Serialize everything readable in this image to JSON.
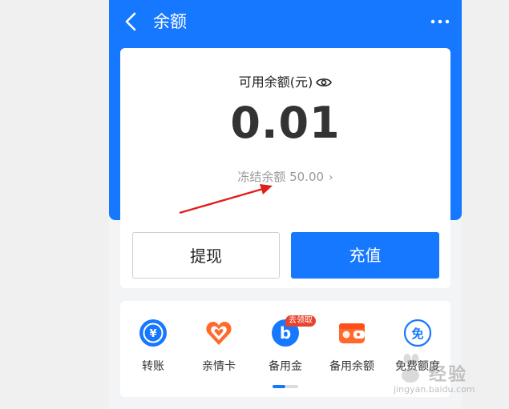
{
  "header": {
    "title": "余额",
    "back_icon": "back-arrow-icon",
    "more_icon": "more-dots-icon"
  },
  "balance": {
    "available_label": "可用余额(元)",
    "amount": "0.01",
    "frozen_label": "冻结余额 50.00"
  },
  "actions": {
    "withdraw": "提现",
    "recharge": "充值"
  },
  "services": [
    {
      "label": "转账",
      "icon": "transfer-icon"
    },
    {
      "label": "亲情卡",
      "icon": "family-card-icon"
    },
    {
      "label": "备用金",
      "icon": "reserve-fund-icon",
      "badge": "去领取"
    },
    {
      "label": "备用余额",
      "icon": "backup-balance-icon"
    },
    {
      "label": "免费额度",
      "icon": "free-quota-icon"
    }
  ],
  "watermark": {
    "text": "经验",
    "sub": "jingyan.baidu.com"
  },
  "colors": {
    "primary": "#1677ff",
    "badge": "#e8412c",
    "icon_blue": "#1677ff",
    "icon_orange": "#ff6a2b"
  }
}
